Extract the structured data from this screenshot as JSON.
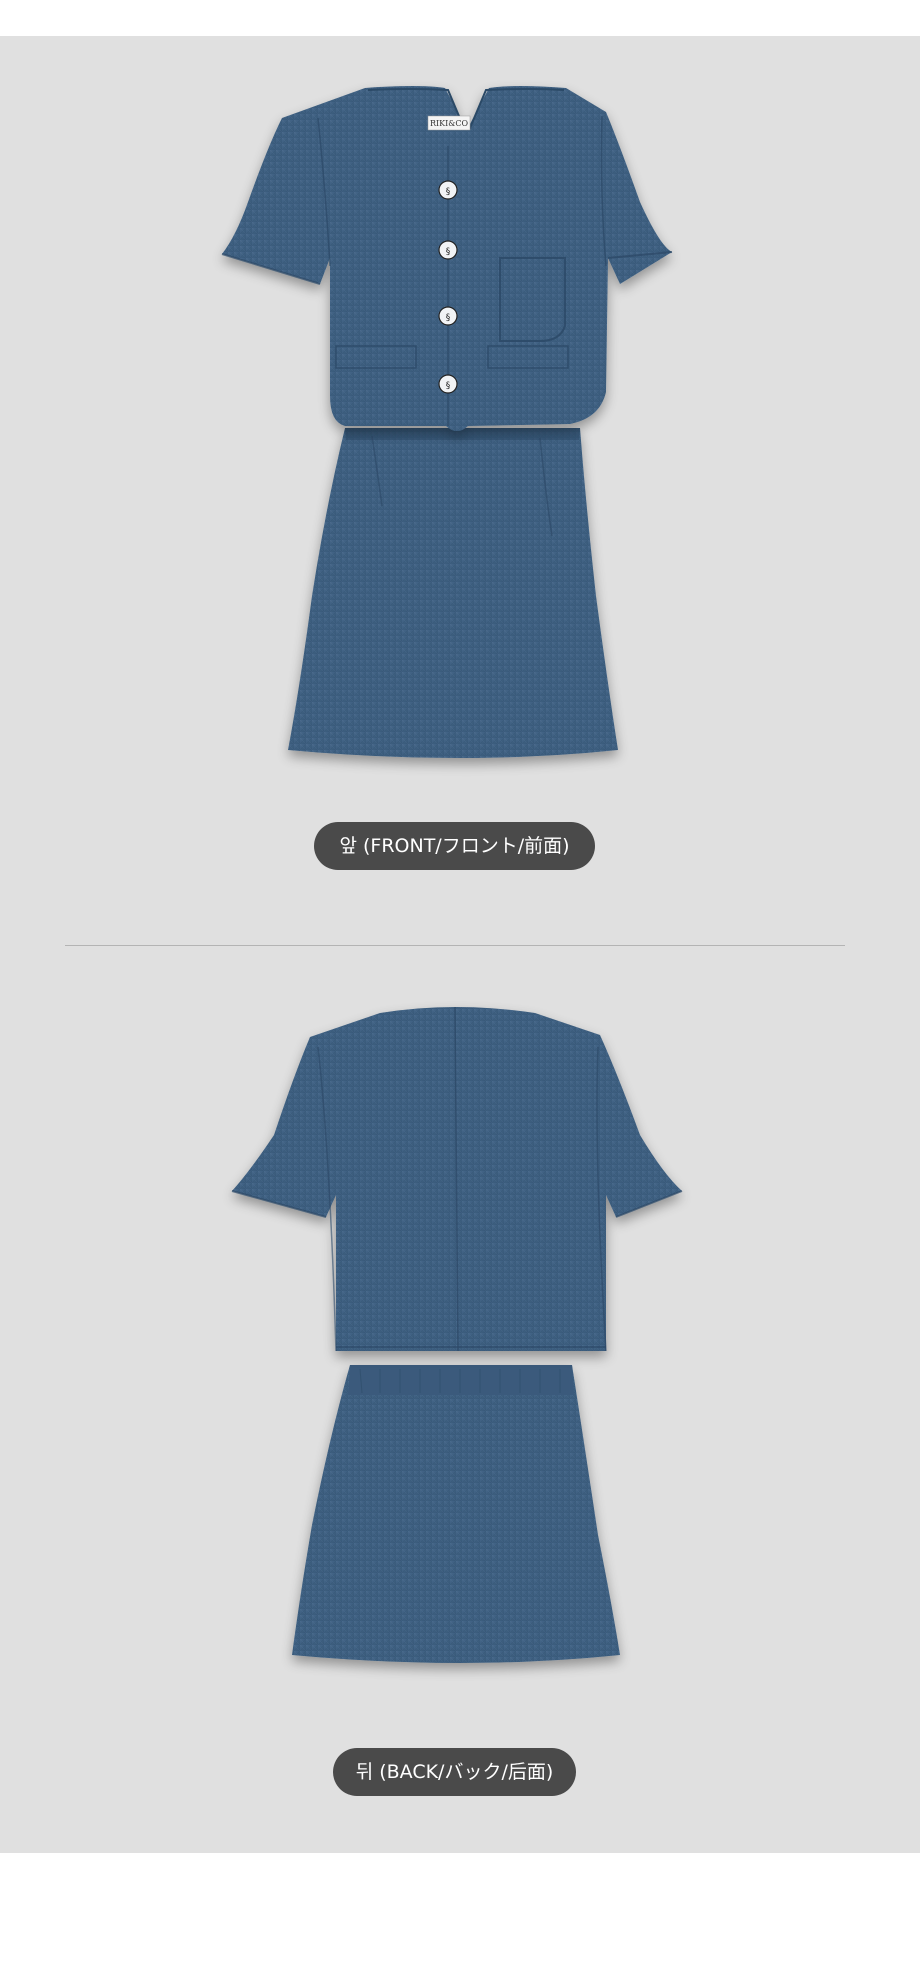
{
  "front": {
    "caption": "앞 (FRONT/フロント/前面)",
    "label_tag": "RIKI&CO"
  },
  "back": {
    "caption": "뒤 (BACK/バック/后面)"
  },
  "colors": {
    "panel_background": "#e0e0e0",
    "garment_navy": "#3f5f80",
    "caption_pill": "#4a4a4a",
    "divider": "#b4b4b4"
  }
}
